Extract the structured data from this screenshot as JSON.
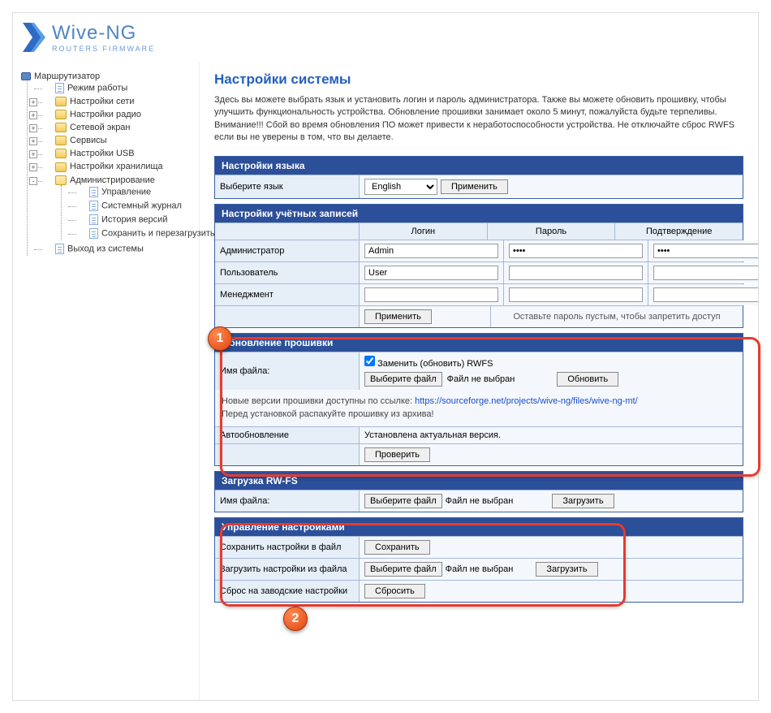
{
  "logo": {
    "main": "Wive-NG",
    "sub": "ROUTERS FIRMWARE"
  },
  "sidebar": {
    "root": "Маршрутизатор",
    "items": [
      "Режим работы",
      "Настройки сети",
      "Настройки радио",
      "Сетевой экран",
      "Сервисы",
      "Настройки USB",
      "Настройки хранилища"
    ],
    "admin": {
      "label": "Администрирование",
      "children": [
        "Управление",
        "Системный журнал",
        "История версий",
        "Сохранить и перезагрузить"
      ]
    },
    "logout": "Выход из системы"
  },
  "page": {
    "title": "Настройки системы",
    "intro": "Здесь вы можете выбрать язык и установить логин и пароль администратора. Также вы можете обновить прошивку, чтобы улучшить функциональность устройства. Обновление прошивки занимает около 5 минут, пожалуйста будьте терпеливы. Внимание!!! Сбой во время обновления ПО может привести к неработоспособности устройства. Не отключайте сброс RWFS если вы не уверены в том, что вы делаете."
  },
  "lang": {
    "header": "Настройки языка",
    "label": "Выберите язык",
    "value": "English",
    "apply": "Применить"
  },
  "accounts": {
    "header": "Настройки учётных записей",
    "cols": {
      "login": "Логин",
      "pass": "Пароль",
      "confirm": "Подтверждение"
    },
    "rows": {
      "admin": {
        "label": "Администратор",
        "login": "Admin",
        "pass": "••••",
        "confirm": "••••"
      },
      "user": {
        "label": "Пользователь",
        "login": "User",
        "pass": "",
        "confirm": ""
      },
      "mgmt": {
        "label": "Менеджмент",
        "login": "",
        "pass": "",
        "confirm": ""
      }
    },
    "apply": "Применить",
    "hint": "Оставьте пароль пустым, чтобы запретить доступ"
  },
  "fw": {
    "header": "Обновление прошивки",
    "file_label": "Имя файла:",
    "replace": "Заменить (обновить) RWFS",
    "choose": "Выберите файл",
    "nofile": "Файл не выбран",
    "update": "Обновить",
    "note_prefix": "Новые версии прошивки доступны по ссылке: ",
    "link": "https://sourceforge.net/projects/wive-ng/files/wive-ng-mt/",
    "note_suffix": "Перед установкой распакуйте прошивку из архива!",
    "auto_label": "Автообновление",
    "auto_status": "Установлена актуальная версия.",
    "check": "Проверить"
  },
  "rwfs": {
    "header": "Загрузка RW-FS",
    "file_label": "Имя файла:",
    "choose": "Выберите файл",
    "nofile": "Файл не выбран",
    "upload": "Загрузить"
  },
  "settings": {
    "header": "Управление настройками",
    "save_label": "Сохранить настройки в файл",
    "save": "Сохранить",
    "load_label": "Загрузить настройки из файла",
    "choose": "Выберите файл",
    "nofile": "Файл не выбран",
    "load": "Загрузить",
    "reset_label": "Сброс на заводские настройки",
    "reset": "Сбросить"
  },
  "badges": {
    "one": "1",
    "two": "2"
  }
}
